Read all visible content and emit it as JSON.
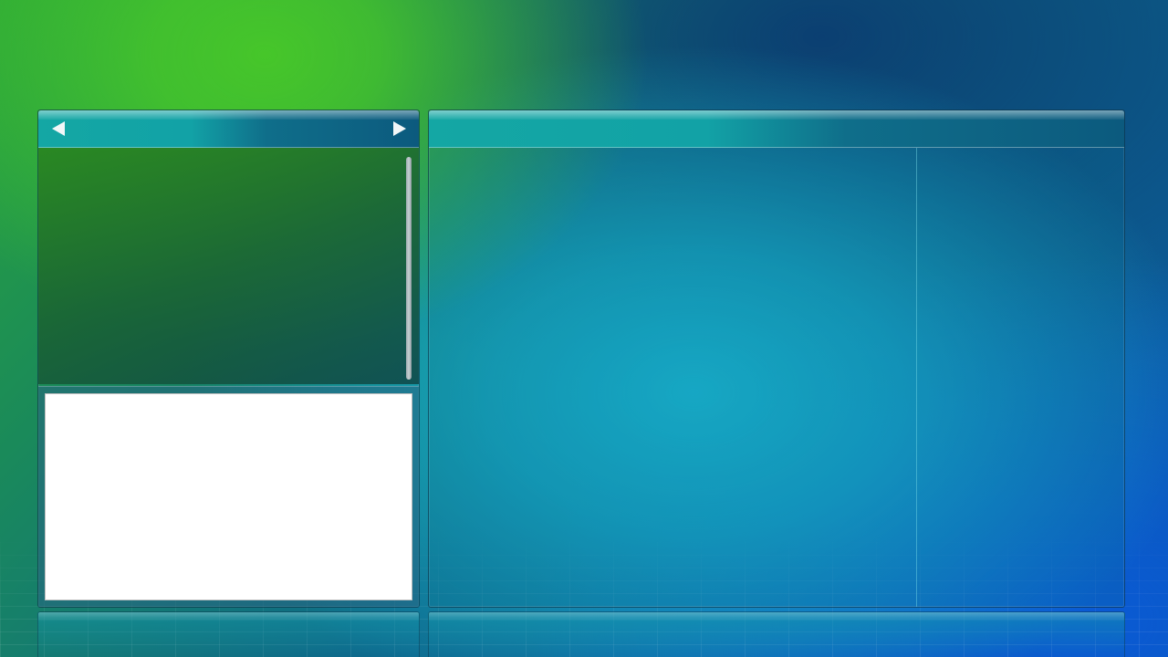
{
  "left_panel": {
    "header": {
      "prev_icon": "triangle-left-icon",
      "next_icon": "triangle-right-icon"
    },
    "list": {
      "items": []
    },
    "preview": {
      "content": ""
    }
  },
  "right_panel": {
    "header": {
      "title": ""
    },
    "columns": {
      "left": [],
      "right": []
    }
  },
  "colors": {
    "header_teal": "#14a7a4",
    "header_dark": "#0c5a7e",
    "list_green": "#2b8a24",
    "scrollbar": "#c7d0d3",
    "preview_bg": "#ffffff",
    "background_green": "#46c62a",
    "background_blue": "#0a5ad6",
    "background_cyan": "#19b6d2"
  }
}
